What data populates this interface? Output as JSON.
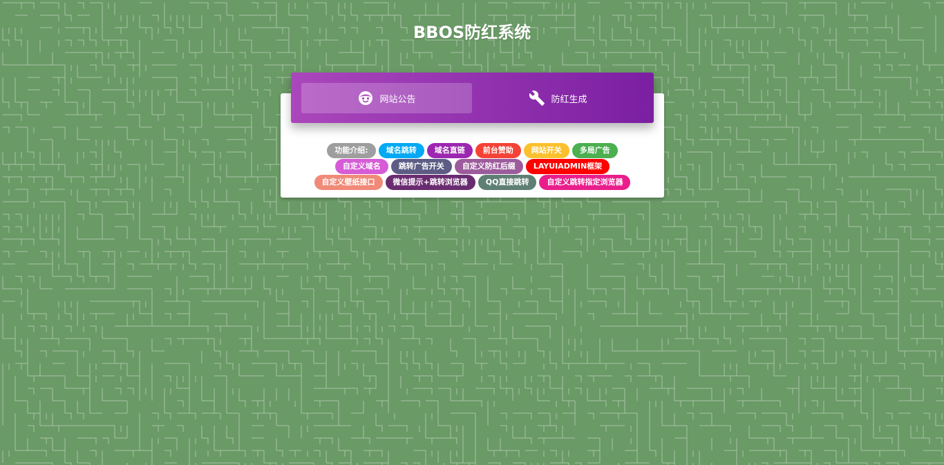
{
  "page": {
    "title": "BBOS防红系统",
    "background_color": "#6a9a66"
  },
  "tabs": [
    {
      "label": "网站公告",
      "icon": "smiley-face-icon",
      "active": true
    },
    {
      "label": "防红生成",
      "icon": "wrench-icon",
      "active": false
    }
  ],
  "header_gradient": [
    "#ab47bc",
    "#7b1fa2"
  ],
  "tag_rows": [
    [
      {
        "label": "功能介绍:",
        "color": "#9e9e9e"
      },
      {
        "label": "域名跳转",
        "color": "#03a9f4"
      },
      {
        "label": "域名直链",
        "color": "#9c27b0"
      },
      {
        "label": "前台赞助",
        "color": "#f44336"
      },
      {
        "label": "网站开关",
        "color": "#fbc02d"
      },
      {
        "label": "多局广告",
        "color": "#4caf50"
      }
    ],
    [
      {
        "label": "自定义域名",
        "color": "#d65cd6"
      },
      {
        "label": "跳转广告开关",
        "color": "#5c5c85"
      },
      {
        "label": "自定义防红后缀",
        "color": "#9c5c9c"
      },
      {
        "label": "LAYUIADMIN框架",
        "color": "#ff0000"
      }
    ],
    [
      {
        "label": "自定义壁纸接口",
        "color": "#f08a78"
      },
      {
        "label": "微信提示+跳转浏览器",
        "color": "#6a2c70"
      },
      {
        "label": "QQ直接跳转",
        "color": "#5f7f74"
      },
      {
        "label": "自定义跳转指定浏览器",
        "color": "#e91e8c"
      }
    ]
  ]
}
